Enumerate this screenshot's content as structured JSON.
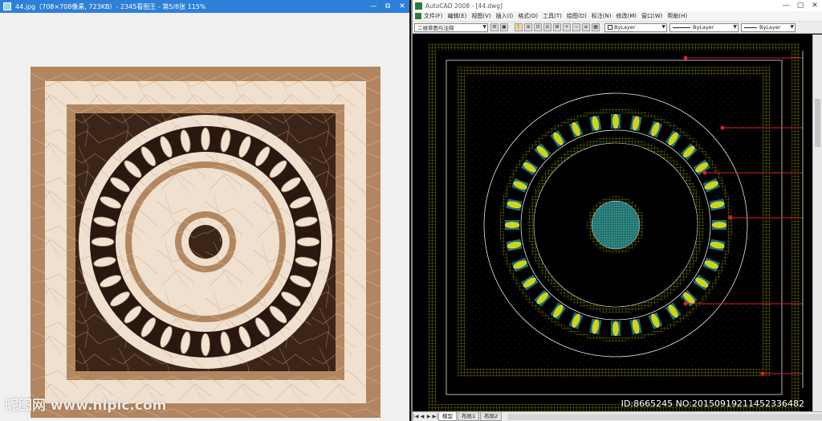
{
  "viewer": {
    "title": "44.jpg（708×708像素, 723KB）- 2345看图王 - 第5/8张 115%",
    "controls": {
      "minimize": "—",
      "maximize": "▢",
      "restore": "⧉",
      "close": "✕"
    }
  },
  "cad": {
    "title": "AutoCAD 2008 - [44.dwg]",
    "controls": {
      "minimize": "—",
      "maximize": "▢",
      "close": "✕"
    },
    "menu": [
      "文件(F)",
      "编辑(E)",
      "视图(V)",
      "插入(I)",
      "格式(O)",
      "工具(T)",
      "绘图(D)",
      "标注(N)",
      "修改(M)",
      "窗口(W)",
      "帮助(H)"
    ],
    "toolbar": {
      "workspace": "二维草图与注释",
      "layer": "ByLayer",
      "linetype": "ByLayer",
      "lineweight": "ByLayer"
    },
    "tabs": [
      "模型",
      "布局1",
      "布局2"
    ]
  },
  "watermark": "昵图网 www.nipic.com",
  "image_id": "ID:8665245 NO:20150919211452336482",
  "colors": {
    "viewer_title_bar": "#2e7fd7",
    "cad_background": "#000000",
    "cad_yellow": "#d4d400",
    "cad_cyan": "#2fa7a0",
    "cad_red_leader": "#e02020",
    "marble_dark": "#3a2417",
    "marble_light": "#efdfcf",
    "marble_brown": "#a57a50"
  }
}
